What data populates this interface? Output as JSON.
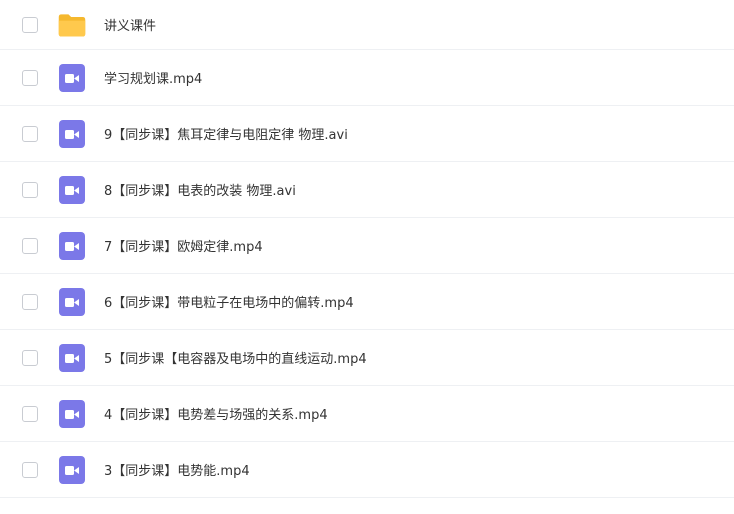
{
  "files": [
    {
      "name": "讲义课件",
      "icon": "folder-icon",
      "type": "folder"
    },
    {
      "name": "学习规划课.mp4",
      "icon": "video-file-icon",
      "type": "video"
    },
    {
      "name": "9【同步课】焦耳定律与电阻定律 物理.avi",
      "icon": "video-file-icon",
      "type": "video"
    },
    {
      "name": "8【同步课】电表的改装 物理.avi",
      "icon": "video-file-icon",
      "type": "video"
    },
    {
      "name": "7【同步课】欧姆定律.mp4",
      "icon": "video-file-icon",
      "type": "video"
    },
    {
      "name": "6【同步课】带电粒子在电场中的偏转.mp4",
      "icon": "video-file-icon",
      "type": "video"
    },
    {
      "name": "5【同步课【电容器及电场中的直线运动.mp4",
      "icon": "video-file-icon",
      "type": "video"
    },
    {
      "name": "4【同步课】电势差与场强的关系.mp4",
      "icon": "video-file-icon",
      "type": "video"
    },
    {
      "name": "3【同步课】电势能.mp4",
      "icon": "video-file-icon",
      "type": "video"
    }
  ],
  "colors": {
    "folder": "#ffc94d",
    "folder_tab": "#f5b82e",
    "video": "#7b78e8",
    "text": "#333333",
    "divider": "#eef0f3"
  }
}
